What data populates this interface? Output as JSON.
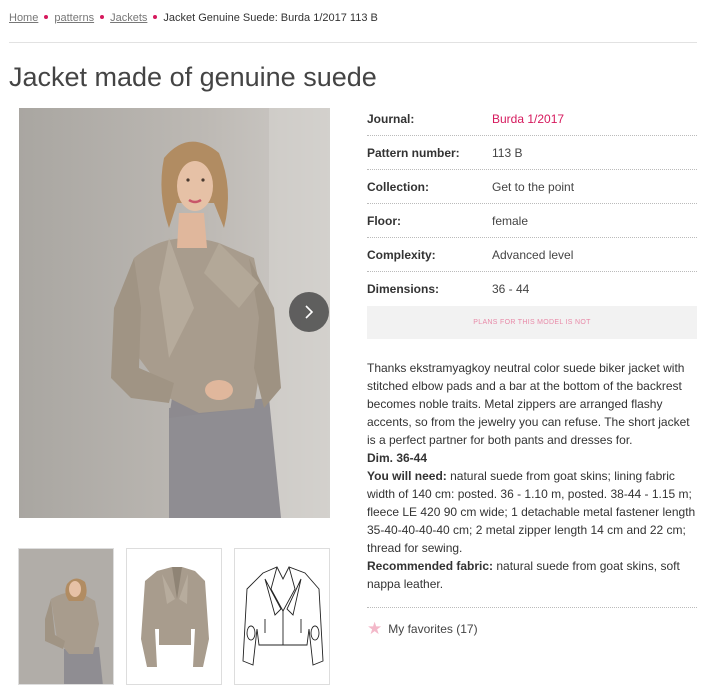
{
  "breadcrumb": {
    "items": [
      "Home",
      "patterns",
      "Jackets"
    ],
    "current": "Jacket Genuine Suede: Burda 1/2017 113 B"
  },
  "title": "Jacket made of genuine suede",
  "specs": [
    {
      "label": "Journal:",
      "value": "Burda 1/2017"
    },
    {
      "label": "Pattern number:",
      "value": "113 B"
    },
    {
      "label": "Collection:",
      "value": "Get to the point"
    },
    {
      "label": "Floor:",
      "value": "female"
    },
    {
      "label": "Complexity:",
      "value": "Advanced level"
    },
    {
      "label": "Dimensions:",
      "value": "36 - 44"
    }
  ],
  "plans_notice": "PLANS FOR THIS MODEL IS NOT",
  "description": {
    "intro": "Thanks ekstramyagkoy neutral color suede biker jacket with stitched elbow pads and a bar at the bottom of the backrest becomes noble traits. Metal zippers are arranged flashy accents, so from the jewelry you can refuse. The short jacket is a perfect partner for both pants and dresses for.",
    "dim": "Dim. 36-44",
    "need_label": "You will need:",
    "need_text": " natural suede from goat skins; lining fabric width of 140 cm: posted. 36 - 1.10 m, posted. 38-44 - 1.15 m; fleece LE 420 90 cm wide; 1 detachable metal fastener length 35-40-40-40-40 cm; 2 metal zipper length 14 cm and 22 cm; thread for sewing.",
    "fabric_label": "Recommended fabric:",
    "fabric_text": " natural suede from goat skins, soft nappa leather."
  },
  "favorites": {
    "label": "My favorites (17)",
    "icon": "star-icon"
  },
  "icons": {
    "next": "chevron-right-icon"
  },
  "colors": {
    "accent": "#d6195d",
    "jacket": "#a89c8d",
    "dress": "#8f8d92",
    "wall": "#b6b2ad"
  }
}
